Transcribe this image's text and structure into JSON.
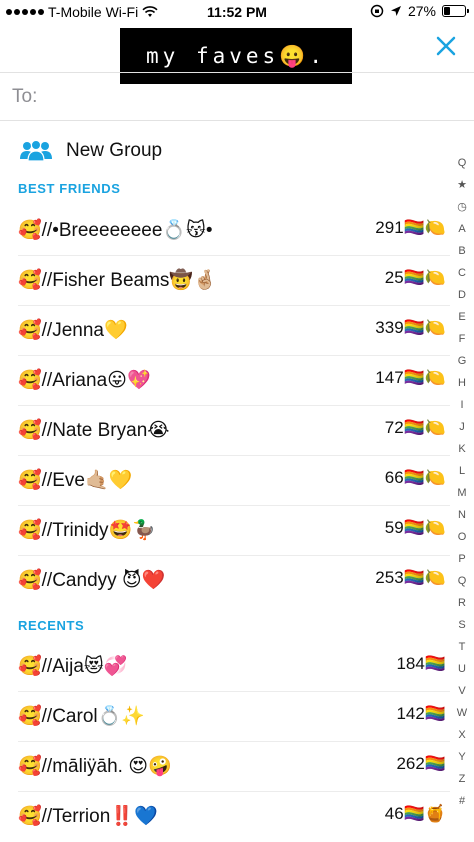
{
  "status_bar": {
    "carrier": "T-Mobile Wi-Fi",
    "time": "11:52 PM",
    "battery": "27%"
  },
  "caption": "my faves😛.",
  "to_label": "To:",
  "new_group_label": "New Group",
  "sections": {
    "best_friends": "BEST FRIENDS",
    "recents": "RECENTS"
  },
  "best_friends": [
    {
      "name": "🥰//•Breeeeeeee💍😽•",
      "score": "291🏳️‍🌈🍋"
    },
    {
      "name": "🥰//Fisher Beams🤠🤞🏼",
      "score": "25🏳️‍🌈🍋"
    },
    {
      "name": "🥰//Jenna💛",
      "score": "339🏳️‍🌈🍋"
    },
    {
      "name": "🥰//Ariana😛💖",
      "score": "147🏳️‍🌈🍋"
    },
    {
      "name": "🥰//Nate Bryan😭",
      "score": "72🏳️‍🌈🍋"
    },
    {
      "name": "🥰//Eve🤙🏼💛",
      "score": "66🏳️‍🌈🍋"
    },
    {
      "name": "🥰//Trinidy🤩🦆",
      "score": "59🏳️‍🌈🍋"
    },
    {
      "name": "🥰//Candyy 😈❤️",
      "score": "253🏳️‍🌈🍋"
    }
  ],
  "recents": [
    {
      "name": "🥰//Aija😻💞",
      "score": "184🏳️‍🌈"
    },
    {
      "name": "🥰//Carol💍✨",
      "score": "142🏳️‍🌈"
    },
    {
      "name": "🥰//māliÿāh. 😍🤪",
      "score": "262🏳️‍🌈"
    },
    {
      "name": "🥰//Terrion‼️💙",
      "score": "46🏳️‍🌈🍯"
    }
  ],
  "alphabet_index": [
    "Q",
    "★",
    "◷",
    "A",
    "B",
    "C",
    "D",
    "E",
    "F",
    "G",
    "H",
    "I",
    "J",
    "K",
    "L",
    "M",
    "N",
    "O",
    "P",
    "Q",
    "R",
    "S",
    "T",
    "U",
    "V",
    "W",
    "X",
    "Y",
    "Z",
    "#"
  ],
  "colors": {
    "accent": "#1aa3e0",
    "caption_bg": "#000000"
  }
}
